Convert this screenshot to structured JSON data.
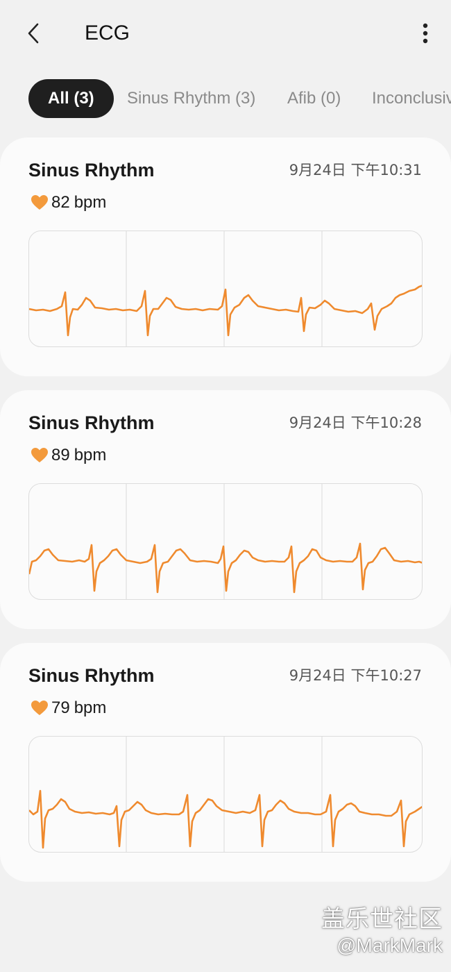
{
  "header": {
    "title": "ECG",
    "back_icon": "back-arrow-icon",
    "more_icon": "more-vertical-icon"
  },
  "tabs": [
    {
      "label": "All (3)",
      "active": true
    },
    {
      "label": "Sinus Rhythm (3)",
      "active": false
    },
    {
      "label": "Afib (0)",
      "active": false
    },
    {
      "label": "Inconclusive",
      "active": false
    }
  ],
  "colors": {
    "accent": "#ef8a2e",
    "heart": "#f39a3c",
    "active_tab_bg": "#1f1f1f",
    "card_bg": "#fbfbfb",
    "page_bg": "#f1f1f1"
  },
  "records": [
    {
      "title": "Sinus Rhythm",
      "time": "9月24日 下午10:31",
      "bpm": "82",
      "unit": "bpm",
      "heart_icon": "heart-icon"
    },
    {
      "title": "Sinus Rhythm",
      "time": "9月24日 下午10:28",
      "bpm": "89",
      "unit": "bpm",
      "heart_icon": "heart-icon"
    },
    {
      "title": "Sinus Rhythm",
      "time": "9月24日 下午10:27",
      "bpm": "79",
      "unit": "bpm",
      "heart_icon": "heart-icon"
    }
  ],
  "watermark": {
    "line1": "盖乐世社区",
    "line2": "@MarkMark"
  }
}
